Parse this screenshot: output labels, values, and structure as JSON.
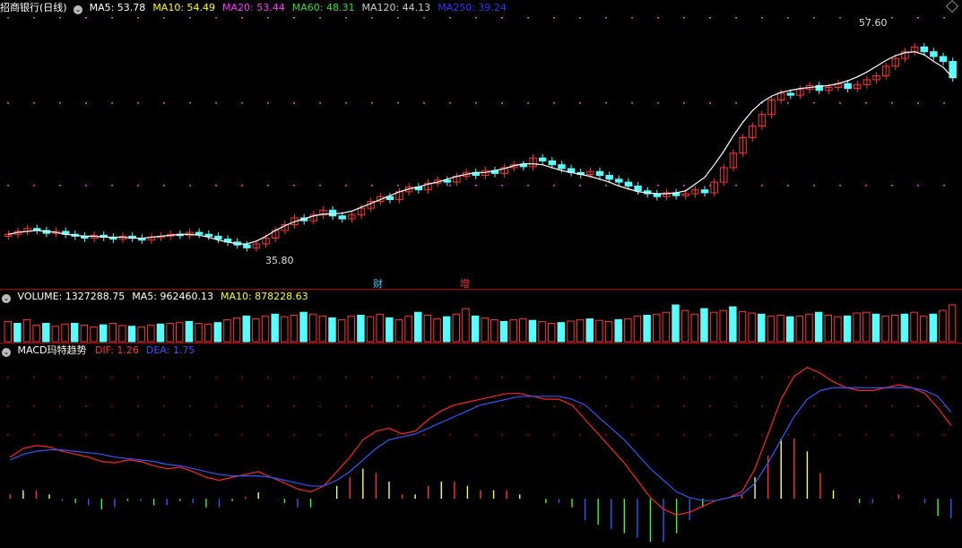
{
  "main": {
    "title": "招商银行(日线)",
    "indicators": [
      {
        "label": "MA5: 53.78",
        "color": "#ffffff"
      },
      {
        "label": "MA10: 54.49",
        "color": "#ffff00"
      },
      {
        "label": "MA20: 53.44",
        "color": "#ff33ff"
      },
      {
        "label": "MA60: 48.31",
        "color": "#33dd33"
      },
      {
        "label": "MA120: 44.13",
        "color": "#cccccc"
      },
      {
        "label": "MA250: 39.24",
        "color": "#3333ff"
      }
    ],
    "high_label": "57.60",
    "low_label": "35.80",
    "events": [
      {
        "label": "财",
        "color": "#33ccff"
      },
      {
        "label": "增",
        "color": "#ff3333"
      }
    ]
  },
  "volume": {
    "indicators": [
      {
        "label": "VOLUME: 1327288.75",
        "color": "#ffffff"
      },
      {
        "label": "MA5: 962460.13",
        "color": "#ffffff"
      },
      {
        "label": "MA10: 878228.63",
        "color": "#ffff00"
      }
    ]
  },
  "macd": {
    "title": "MACD玛特趋势",
    "indicators": [
      {
        "label": "DIF: 1.26",
        "color": "#ff3333"
      },
      {
        "label": "DEA: 1.75",
        "color": "#3355ff"
      }
    ]
  },
  "colors": {
    "up": "#ff3333",
    "down": "#55ffff",
    "grid": "#b00000"
  },
  "chart_data": [
    {
      "type": "candlestick",
      "ylim": [
        34,
        60
      ],
      "close": [
        37.6,
        37.9,
        38.2,
        38.0,
        37.7,
        37.9,
        37.6,
        37.4,
        37.2,
        37.5,
        37.3,
        37.1,
        37.4,
        37.2,
        37.0,
        37.3,
        37.4,
        37.6,
        37.5,
        37.8,
        37.6,
        37.4,
        37.1,
        36.8,
        36.5,
        36.2,
        36.6,
        37.2,
        38.0,
        38.6,
        39.3,
        39.0,
        39.6,
        40.1,
        39.5,
        39.2,
        39.6,
        40.3,
        41.0,
        41.5,
        41.2,
        42.0,
        42.5,
        42.2,
        42.9,
        43.2,
        43.0,
        43.6,
        44.0,
        43.7,
        44.2,
        43.9,
        44.5,
        44.8,
        44.6,
        45.5,
        45.2,
        44.8,
        44.4,
        44.0,
        43.8,
        44.1,
        43.7,
        43.3,
        43.0,
        42.6,
        42.1,
        41.8,
        41.5,
        41.9,
        41.6,
        41.8,
        42.2,
        41.9,
        43.0,
        44.5,
        46.0,
        47.6,
        48.8,
        50.0,
        51.5,
        52.2,
        52.0,
        52.6,
        53.0,
        52.5,
        52.8,
        53.2,
        52.7,
        53.1,
        53.6,
        54.0,
        55.0,
        55.8,
        56.5,
        57.0,
        56.5,
        56.0,
        55.5,
        53.8
      ],
      "ma5": [
        37.6,
        37.8,
        37.9,
        38.0,
        37.9,
        37.8,
        37.6,
        37.5,
        37.4,
        37.4,
        37.3,
        37.3,
        37.3,
        37.2,
        37.2,
        37.3,
        37.4,
        37.5,
        37.6,
        37.6,
        37.5,
        37.3,
        37.0,
        36.8,
        36.6,
        36.6,
        36.9,
        37.4,
        38.0,
        38.5,
        38.9,
        39.2,
        39.5,
        39.7,
        39.7,
        39.8,
        40.0,
        40.4,
        40.8,
        41.2,
        41.6,
        42.0,
        42.3,
        42.5,
        42.8,
        43.0,
        43.3,
        43.6,
        43.8,
        44.0,
        44.0,
        44.2,
        44.4,
        44.7,
        44.9,
        44.9,
        44.8,
        44.5,
        44.2,
        44.0,
        43.8,
        43.6,
        43.3,
        43.0,
        42.6,
        42.3,
        42.0,
        41.9,
        41.8,
        41.8,
        41.9,
        42.1,
        42.8,
        43.5,
        44.8,
        46.2,
        47.8,
        49.2,
        50.4,
        51.3,
        51.9,
        52.3,
        52.5,
        52.7,
        52.8,
        52.9,
        53.0,
        53.2,
        53.5,
        53.9,
        54.4,
        55.0,
        55.6,
        56.1,
        56.4,
        56.5,
        56.2,
        55.5,
        54.9,
        53.8
      ]
    },
    {
      "type": "bar",
      "series": [
        {
          "name": "VOLUME",
          "values": [
            0.55,
            0.5,
            0.6,
            0.45,
            0.5,
            0.42,
            0.48,
            0.5,
            0.45,
            0.4,
            0.46,
            0.5,
            0.44,
            0.42,
            0.4,
            0.45,
            0.48,
            0.5,
            0.52,
            0.55,
            0.5,
            0.48,
            0.52,
            0.6,
            0.65,
            0.7,
            0.62,
            0.7,
            0.75,
            0.68,
            0.72,
            0.8,
            0.75,
            0.7,
            0.65,
            0.6,
            0.7,
            0.72,
            0.68,
            0.75,
            0.65,
            0.6,
            0.7,
            0.8,
            0.72,
            0.62,
            0.68,
            0.75,
            0.9,
            0.7,
            0.65,
            0.6,
            0.55,
            0.6,
            0.62,
            0.58,
            0.55,
            0.5,
            0.52,
            0.56,
            0.6,
            0.62,
            0.58,
            0.55,
            0.6,
            0.62,
            0.7,
            0.72,
            0.75,
            0.8,
            1.0,
            0.85,
            0.75,
            0.9,
            0.8,
            0.85,
            0.95,
            0.82,
            0.78,
            0.75,
            0.7,
            0.72,
            0.68,
            0.7,
            0.75,
            0.8,
            0.72,
            0.68,
            0.7,
            0.78,
            0.8,
            0.75,
            0.7,
            0.72,
            0.75,
            0.8,
            0.7,
            0.75,
            0.85,
            1.0
          ]
        }
      ]
    },
    {
      "type": "line",
      "ylim": [
        -2.6,
        3.6
      ],
      "series": [
        {
          "name": "DIF",
          "values": [
            0.2,
            0.5,
            0.6,
            0.55,
            0.4,
            0.3,
            0.2,
            0.05,
            0.0,
            0.1,
            0.05,
            -0.1,
            -0.2,
            -0.15,
            -0.3,
            -0.5,
            -0.6,
            -0.5,
            -0.4,
            -0.3,
            -0.5,
            -0.7,
            -0.9,
            -1.0,
            -0.8,
            -0.3,
            0.2,
            0.8,
            1.1,
            1.2,
            1.0,
            1.1,
            1.5,
            1.8,
            2.0,
            2.1,
            2.2,
            2.3,
            2.4,
            2.4,
            2.3,
            2.2,
            2.2,
            2.0,
            1.5,
            1.0,
            0.5,
            0.0,
            -0.6,
            -1.2,
            -1.6,
            -1.8,
            -1.7,
            -1.5,
            -1.3,
            -1.2,
            -1.0,
            -0.2,
            1.0,
            2.2,
            3.0,
            3.3,
            3.1,
            2.8,
            2.6,
            2.5,
            2.5,
            2.6,
            2.7,
            2.6,
            2.4,
            1.9,
            1.3
          ]
        },
        {
          "name": "DEA",
          "values": [
            0.1,
            0.3,
            0.4,
            0.45,
            0.45,
            0.4,
            0.35,
            0.3,
            0.2,
            0.15,
            0.1,
            0.05,
            -0.05,
            -0.1,
            -0.2,
            -0.3,
            -0.4,
            -0.45,
            -0.45,
            -0.45,
            -0.5,
            -0.6,
            -0.7,
            -0.8,
            -0.8,
            -0.6,
            -0.3,
            0.1,
            0.5,
            0.8,
            0.9,
            1.0,
            1.2,
            1.4,
            1.6,
            1.8,
            2.0,
            2.1,
            2.2,
            2.3,
            2.3,
            2.3,
            2.3,
            2.2,
            2.0,
            1.6,
            1.2,
            0.8,
            0.3,
            -0.2,
            -0.6,
            -1.0,
            -1.2,
            -1.3,
            -1.3,
            -1.2,
            -1.1,
            -0.7,
            0.0,
            0.8,
            1.6,
            2.2,
            2.5,
            2.6,
            2.6,
            2.6,
            2.6,
            2.6,
            2.6,
            2.6,
            2.5,
            2.3,
            1.75
          ]
        }
      ]
    }
  ]
}
